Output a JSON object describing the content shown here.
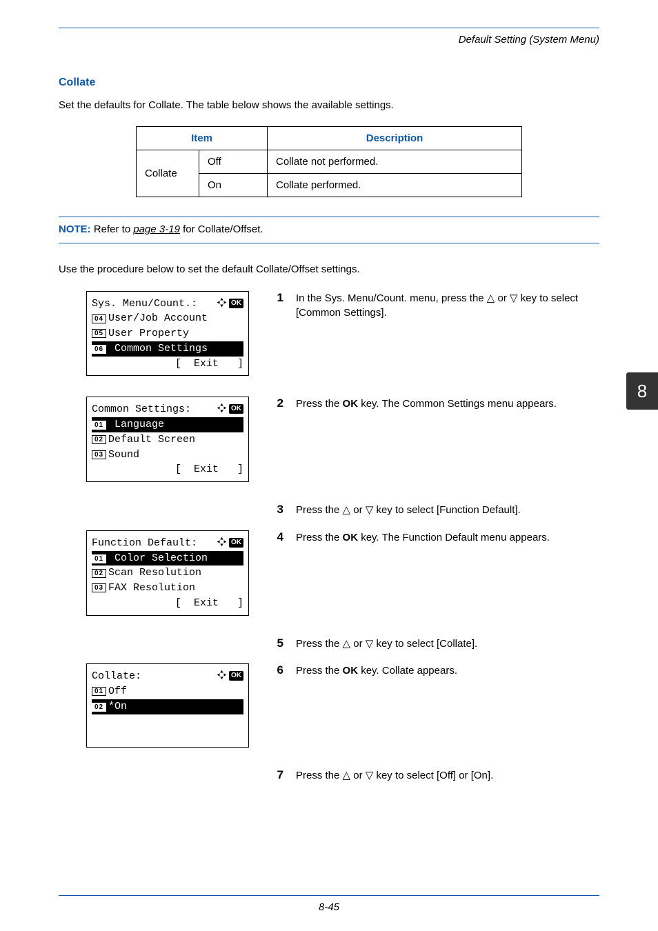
{
  "breadcrumb": "Default Setting (System Menu)",
  "section_heading": "Collate",
  "intro": "Set the defaults for Collate. The table below shows the available settings.",
  "table": {
    "head_item": "Item",
    "head_desc": "Description",
    "rows": [
      {
        "item_group": "Collate",
        "item_value": "Off",
        "desc": "Collate not performed."
      },
      {
        "item_group": "",
        "item_value": "On",
        "desc": "Collate performed."
      }
    ]
  },
  "note": {
    "label": "NOTE:",
    "before_ref": " Refer to ",
    "ref": "page 3-19",
    "after_ref": " for Collate/Offset."
  },
  "procedure_intro": "Use the procedure below to set the default Collate/Offset settings.",
  "steps": {
    "s1": "In the Sys. Menu/Count. menu, press the △ or ▽ key to select [Common Settings].",
    "s2a": "Press the ",
    "s2b": "OK",
    "s2c": " key. The Common Settings menu appears.",
    "s3": "Press the △ or ▽ key to select [Function Default].",
    "s4a": "Press the ",
    "s4b": "OK",
    "s4c": " key. The Function Default menu appears.",
    "s5": "Press the △ or ▽ key to select [Collate].",
    "s6a": "Press the ",
    "s6b": "OK",
    "s6c": " key. Collate appears.",
    "s7": "Press the △ or ▽ key to select [Off] or [On]."
  },
  "lcd1": {
    "title": "Sys. Menu/Count.:",
    "n1": "04",
    "l1": "User/Job Account",
    "n2": "05",
    "l2": "User Property",
    "n3": "06",
    "l3": "Common Settings",
    "exit": "[  Exit   ]"
  },
  "lcd2": {
    "title": "Common Settings:",
    "n1": "01",
    "l1": "Language",
    "n2": "02",
    "l2": "Default Screen",
    "n3": "03",
    "l3": "Sound",
    "exit": "[  Exit   ]"
  },
  "lcd3": {
    "title": "Function Default:",
    "n1": "01",
    "l1": "Color Selection",
    "n2": "02",
    "l2": "Scan Resolution",
    "n3": "03",
    "l3": "FAX Resolution",
    "exit": "[  Exit   ]"
  },
  "lcd4": {
    "title": "Collate:",
    "n1": "01",
    "l1": "Off",
    "n2": "02",
    "l2": "*On"
  },
  "ok_badge": "OK",
  "side_tab": "8",
  "footer": "8-45"
}
